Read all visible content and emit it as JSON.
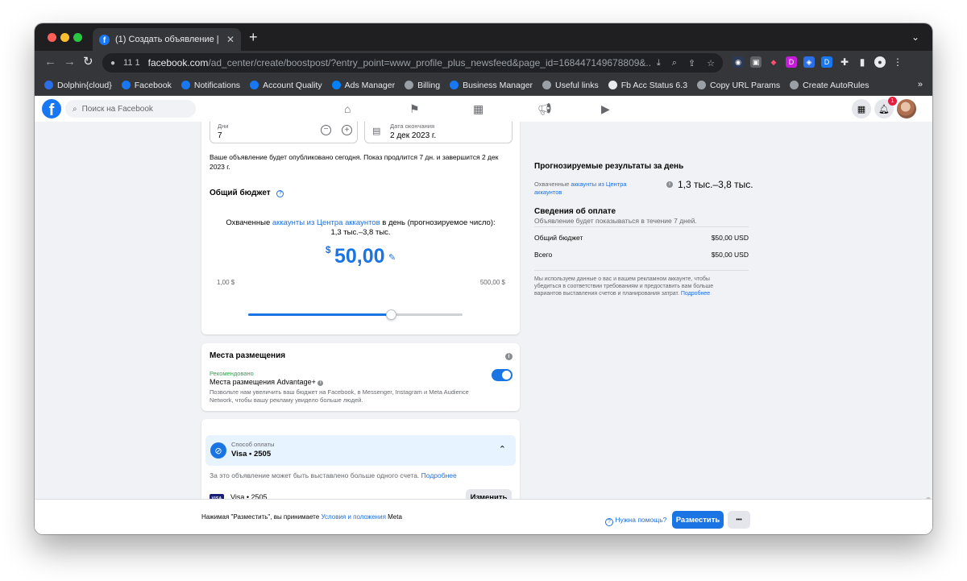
{
  "browser": {
    "tab_title": "(1) Создать объявление | Fac",
    "new_tab_label": "+",
    "omnibox_num": "11 1",
    "url_host": "facebook.com",
    "url_path": "/ad_center/create/boostpost/?entry_point=www_profile_plus_newsfeed&page_id=1684471496788​09&...",
    "bookmarks": [
      {
        "label": "Dolphin{cloud}",
        "color": "#2a6ee8"
      },
      {
        "label": "Facebook",
        "color": "#1877f2"
      },
      {
        "label": "Notifications",
        "color": "#1877f2"
      },
      {
        "label": "Account Quality",
        "color": "#1877f2"
      },
      {
        "label": "Ads Manager",
        "color": "#0081fb"
      },
      {
        "label": "Billing",
        "color": "#9aa0a6"
      },
      {
        "label": "Business Manager",
        "color": "#1877f2"
      },
      {
        "label": "Useful links",
        "color": "#9aa0a6"
      },
      {
        "label": "Fb Acc Status 6.3",
        "color": "#e8eaed"
      },
      {
        "label": "Copy URL Params",
        "color": "#9aa0a6"
      },
      {
        "label": "Create AutoRules",
        "color": "#9aa0a6"
      }
    ]
  },
  "header": {
    "search_placeholder": "Поиск на Facebook",
    "notification_count": "1"
  },
  "duration": {
    "days_label": "Дни",
    "days_value": "7",
    "end_date_label": "Дата окончания",
    "end_date_value": "2 дек 2023 г.",
    "schedule_note": "Ваше объявление будет опубликовано сегодня. Показ продлится 7 дн. и завершится 2 дек 2023 г."
  },
  "budget": {
    "title": "Общий бюджет",
    "reach_prefix": "Охваченные ",
    "reach_link": "аккаунты из Центра аккаунтов",
    "reach_suffix": " в день (прогнозируемое число):",
    "reach_range": "1,3 тыс.–3,8 тыс.",
    "currency_symbol": "$",
    "amount": "50,00",
    "slider_min": "1,00 $",
    "slider_max": "500,00 $",
    "slider_fraction": 0.667
  },
  "placements": {
    "title": "Места размещения",
    "recommended": "Рекомендовано",
    "advantage_label": "Места размещения Advantage+",
    "advantage_desc": "Позвольте нам увеличить ваш бюджет на Facebook, в Messenger, Instagram и Meta Audience Network, чтобы вашу рекламу увидело больше людей.",
    "toggle_on": true
  },
  "payment": {
    "method_label": "Способ оплаты",
    "method_value": "Visa • 2505",
    "multi_invoice_note": "За это объявление может быть выставлено больше одного счета.",
    "more_link": "Подробнее",
    "card_brand": "VISA",
    "card_label": "Visa • 2505",
    "change_button": "Изменить"
  },
  "summary": {
    "forecast_title": "Прогнозируемые результаты за день",
    "reach_prefix": "Охваченные ",
    "reach_link": "аккаунты из Центра аккаунтов",
    "reach_value": "1,3 тыс.–3,8 тыс.",
    "payment_title": "Сведения об оплате",
    "payment_subtitle": "Объявление будет показываться в течение 7 дней.",
    "total_budget_label": "Общий бюджет",
    "total_budget_value": "$50,00 USD",
    "total_label": "Всего",
    "total_value": "$50,00 USD",
    "disclaimer": "Мы используем данные о вас и вашем рекламном аккаунте, чтобы убедиться в соответствии требованиям и предоставить вам больше вариантов выставления счетов и планирования затрат.",
    "disclaimer_link": "Подробнее"
  },
  "footer": {
    "terms_prefix": "Нажимая \"Разместить\", вы принимаете ",
    "terms_link": "Условия и положения",
    "terms_suffix": " Meta",
    "help_label": "Нужна помощь?",
    "publish_button": "Разместить",
    "more_button": "•••"
  }
}
